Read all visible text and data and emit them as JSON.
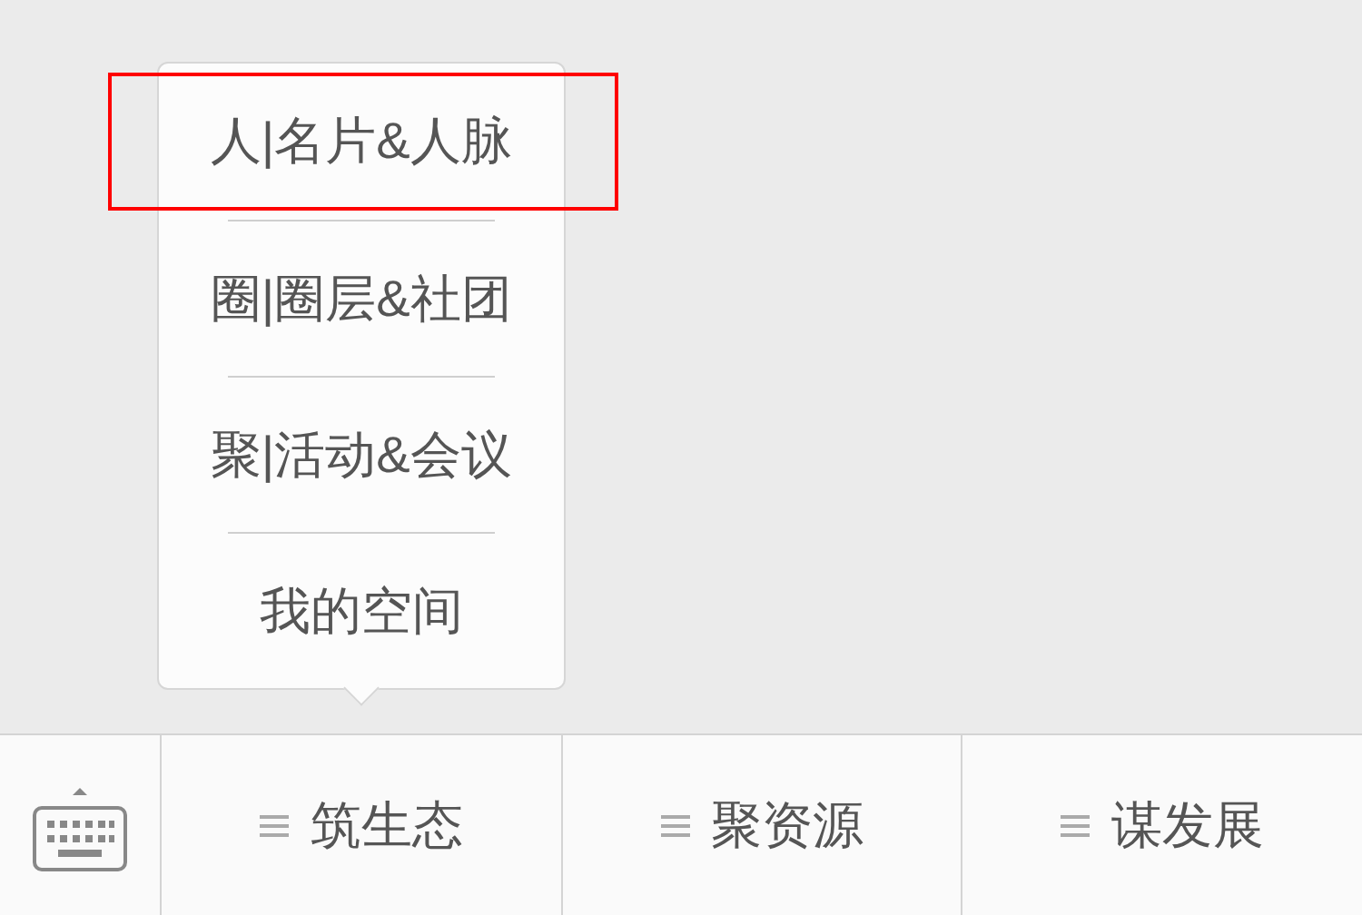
{
  "popup_menu": {
    "items": [
      {
        "label": "人|名片&人脉",
        "highlighted": true
      },
      {
        "label": "圈|圈层&社团",
        "highlighted": false
      },
      {
        "label": "聚|活动&会议",
        "highlighted": false
      },
      {
        "label": "我的空间",
        "highlighted": false
      }
    ]
  },
  "bottom_menu": {
    "items": [
      {
        "label": "筑生态",
        "expanded": true
      },
      {
        "label": "聚资源",
        "expanded": false
      },
      {
        "label": "谋发展",
        "expanded": false
      }
    ]
  }
}
